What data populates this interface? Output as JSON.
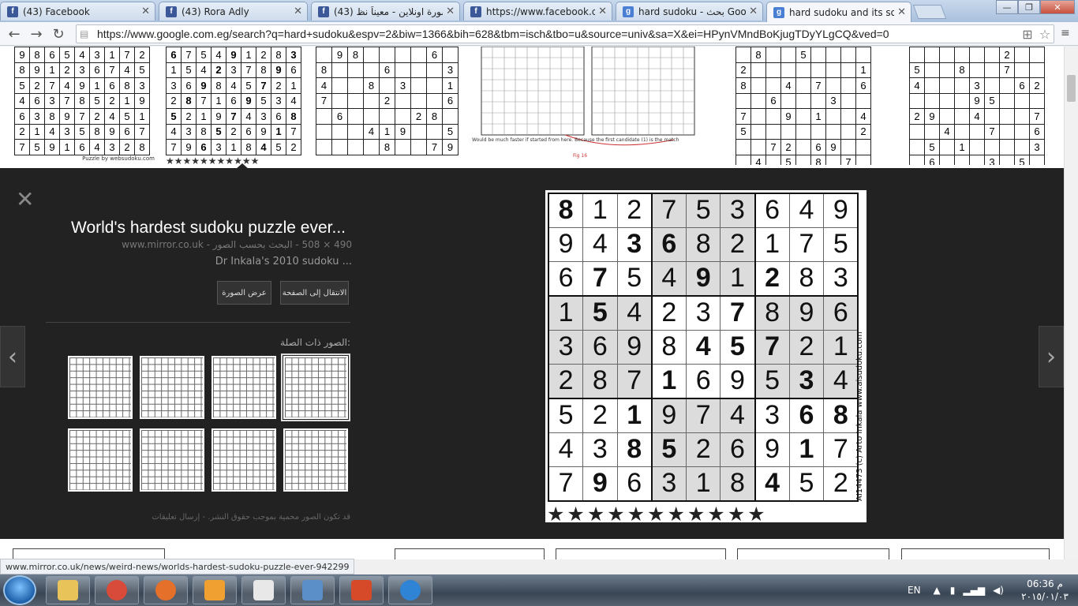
{
  "tabs": [
    {
      "title": "(43) Facebook",
      "favicon": "facebook-icon",
      "favicon_color": "#3b5998",
      "glyph": "f"
    },
    {
      "title": "(43) Rora Adly",
      "favicon": "facebook-icon",
      "favicon_color": "#3b5998",
      "glyph": "f"
    },
    {
      "title": "(43) مشورة اونلاين - معيناً نظ",
      "favicon": "facebook-icon",
      "favicon_color": "#3b5998",
      "glyph": "f"
    },
    {
      "title": "https://www.facebook.co",
      "favicon": "facebook-icon",
      "favicon_color": "#3b5998",
      "glyph": "f"
    },
    {
      "title": "hard sudoku - بحث Google",
      "favicon": "google-icon",
      "favicon_color": "#4a7fd4",
      "glyph": "g"
    },
    {
      "title": "hard sudoku and its soluti",
      "favicon": "google-icon",
      "favicon_color": "#4a7fd4",
      "glyph": "g"
    }
  ],
  "omnibox": {
    "url": "https://www.google.com.eg/search?q=hard+sudoku&espv=2&biw=1366&bih=628&tbm=isch&tbo=u&source=univ&sa=X&ei=HPynVMndBoKjugTDyYLgCQ&ved=0"
  },
  "preview": {
    "title": "World's hardest sudoku puzzle ever...",
    "meta": "www.mirror.co.uk - ‏490 × 508 - البحث بحسب الصور",
    "description": "Dr Inkala's 2010 sudoku ...",
    "visit_button": "الانتقال إلى الصفحة",
    "view_button": "عرض الصورة",
    "related_label": "الصور ذات الصلة:",
    "footer": "قد تكون الصور محمية بموجب حقوق النشر. - إرسال تعليقات"
  },
  "sudoku": {
    "rows": [
      [
        "8",
        "1",
        "2",
        "7",
        "5",
        "3",
        "6",
        "4",
        "9"
      ],
      [
        "9",
        "4",
        "3",
        "6",
        "8",
        "2",
        "1",
        "7",
        "5"
      ],
      [
        "6",
        "7",
        "5",
        "4",
        "9",
        "1",
        "2",
        "8",
        "3"
      ],
      [
        "1",
        "5",
        "4",
        "2",
        "3",
        "7",
        "8",
        "9",
        "6"
      ],
      [
        "3",
        "6",
        "9",
        "8",
        "4",
        "5",
        "7",
        "2",
        "1"
      ],
      [
        "2",
        "8",
        "7",
        "1",
        "6",
        "9",
        "5",
        "3",
        "4"
      ],
      [
        "5",
        "2",
        "1",
        "9",
        "7",
        "4",
        "3",
        "6",
        "8"
      ],
      [
        "4",
        "3",
        "8",
        "5",
        "2",
        "6",
        "9",
        "1",
        "7"
      ],
      [
        "7",
        "9",
        "6",
        "3",
        "1",
        "8",
        "4",
        "5",
        "2"
      ]
    ],
    "givens": [
      [
        1,
        0,
        0,
        0,
        0,
        0,
        0,
        0,
        0
      ],
      [
        0,
        0,
        1,
        1,
        0,
        0,
        0,
        0,
        0
      ],
      [
        0,
        1,
        0,
        0,
        1,
        0,
        1,
        0,
        0
      ],
      [
        0,
        1,
        0,
        0,
        0,
        1,
        0,
        0,
        0
      ],
      [
        0,
        0,
        0,
        0,
        1,
        1,
        1,
        0,
        0
      ],
      [
        0,
        0,
        0,
        1,
        0,
        0,
        0,
        1,
        0
      ],
      [
        0,
        0,
        1,
        0,
        0,
        0,
        0,
        1,
        1
      ],
      [
        0,
        0,
        1,
        1,
        0,
        0,
        0,
        1,
        0
      ],
      [
        0,
        1,
        0,
        0,
        0,
        0,
        1,
        0,
        0
      ]
    ],
    "credit": "AI14473 (c) Arto Inkala www.aisudoku.com",
    "stars": "★★★★★★★★★★★"
  },
  "top_thumbnails": [
    {
      "rows": [
        [
          "9",
          "8",
          "6",
          "5",
          "4",
          "3",
          "1",
          "7",
          "2"
        ],
        [
          "8",
          "9",
          "1",
          "2",
          "3",
          "6",
          "7",
          "4",
          "5"
        ],
        [
          "5",
          "2",
          "7",
          "4",
          "9",
          "1",
          "6",
          "8",
          "3"
        ],
        [
          "4",
          "6",
          "3",
          "7",
          "8",
          "5",
          "2",
          "1",
          "9"
        ],
        [
          "6",
          "3",
          "8",
          "9",
          "7",
          "2",
          "4",
          "5",
          "1"
        ],
        [
          "2",
          "1",
          "4",
          "3",
          "5",
          "8",
          "9",
          "6",
          "7"
        ],
        [
          "7",
          "5",
          "9",
          "1",
          "6",
          "4",
          "3",
          "2",
          "8"
        ]
      ],
      "caption": "Puzzle by websudoku.com"
    },
    {
      "rows": [
        [
          "6",
          "7",
          "5",
          "4",
          "9",
          "1",
          "2",
          "8",
          "3"
        ],
        [
          "1",
          "5",
          "4",
          "2",
          "3",
          "7",
          "8",
          "9",
          "6"
        ],
        [
          "3",
          "6",
          "9",
          "8",
          "4",
          "5",
          "7",
          "2",
          "1"
        ],
        [
          "2",
          "8",
          "7",
          "1",
          "6",
          "9",
          "5",
          "3",
          "4"
        ],
        [
          "5",
          "2",
          "1",
          "9",
          "7",
          "4",
          "3",
          "6",
          "8"
        ],
        [
          "4",
          "3",
          "8",
          "5",
          "2",
          "6",
          "9",
          "1",
          "7"
        ],
        [
          "7",
          "9",
          "6",
          "3",
          "1",
          "8",
          "4",
          "5",
          "2"
        ]
      ],
      "caption": "★★★★★★★★★★★"
    },
    {
      "rows": [
        [
          "",
          "9",
          "8",
          "",
          "",
          "",
          "",
          "6",
          ""
        ],
        [
          "8",
          "",
          "",
          "",
          "6",
          "",
          "",
          "",
          "3"
        ],
        [
          "4",
          "",
          "",
          "8",
          "",
          "3",
          "",
          "",
          "1"
        ],
        [
          "7",
          "",
          "",
          "",
          "2",
          "",
          "",
          "",
          "6"
        ],
        [
          "",
          "6",
          "",
          "",
          "",
          "",
          "2",
          "8",
          ""
        ],
        [
          "",
          "",
          "",
          "4",
          "1",
          "9",
          "",
          "",
          "5"
        ],
        [
          "",
          "",
          "",
          "",
          "8",
          "",
          "",
          "7",
          "9"
        ]
      ],
      "caption": ""
    },
    {
      "rows": [
        [
          "",
          "8",
          "",
          "",
          "5",
          "",
          "",
          "",
          ""
        ],
        [
          "2",
          "",
          "",
          "",
          "",
          "",
          "",
          "",
          "1"
        ],
        [
          "8",
          "",
          "",
          "4",
          "",
          "7",
          "",
          "",
          "6"
        ],
        [
          "",
          "",
          "6",
          "",
          "",
          "",
          "3",
          "",
          ""
        ],
        [
          "7",
          "",
          "",
          "9",
          "",
          "1",
          "",
          "",
          "4"
        ],
        [
          "5",
          "",
          "",
          "",
          "",
          "",
          "",
          "",
          "2"
        ],
        [
          "",
          "",
          "7",
          "2",
          "",
          "6",
          "9",
          "",
          ""
        ],
        [
          "",
          "4",
          "",
          "5",
          "",
          "8",
          "",
          "7",
          ""
        ]
      ],
      "caption": ""
    },
    {
      "rows": [
        [
          "",
          "",
          "",
          "",
          "",
          "",
          "2",
          "",
          ""
        ],
        [
          "5",
          "",
          "",
          "8",
          "",
          "",
          "7",
          "",
          ""
        ],
        [
          "4",
          "",
          "",
          "",
          "3",
          "",
          "",
          "6",
          "2"
        ],
        [
          "",
          "",
          "",
          "",
          "9",
          "5",
          "",
          "",
          ""
        ],
        [
          "2",
          "9",
          "",
          "",
          "4",
          "",
          "",
          "",
          "7"
        ],
        [
          "",
          "",
          "4",
          "",
          "",
          "7",
          "",
          "",
          "6"
        ],
        [
          "",
          "5",
          "",
          "1",
          "",
          "",
          "",
          "",
          "3"
        ],
        [
          "",
          "6",
          "",
          "",
          "",
          "3",
          "",
          "5",
          ""
        ]
      ],
      "caption": ""
    }
  ],
  "panel_texts": {
    "fig_note": "Would be much faster if started from here. Because the first candidate (1) is the match",
    "fig_label": "Fig 16"
  },
  "status_url": "www.mirror.co.uk/news/weird-news/worlds-hardest-sudoku-puzzle-ever-942299",
  "taskbar": {
    "apps": [
      {
        "name": "windows-explorer-icon",
        "color": "#e7c35a"
      },
      {
        "name": "chrome-icon",
        "color": "#d84b3a"
      },
      {
        "name": "firefox-icon",
        "color": "#e5702a"
      },
      {
        "name": "media-player-icon",
        "color": "#f0a030"
      },
      {
        "name": "notepad-icon",
        "color": "#e8e8e8"
      },
      {
        "name": "picture-viewer-icon",
        "color": "#5a8fc8"
      },
      {
        "name": "presentation-icon",
        "color": "#d64a2a"
      },
      {
        "name": "internet-explorer-icon",
        "color": "#2f84d6"
      }
    ],
    "language": "EN",
    "time": "06:36 م",
    "date": "٢٠١٥/٠١/٠٣"
  }
}
